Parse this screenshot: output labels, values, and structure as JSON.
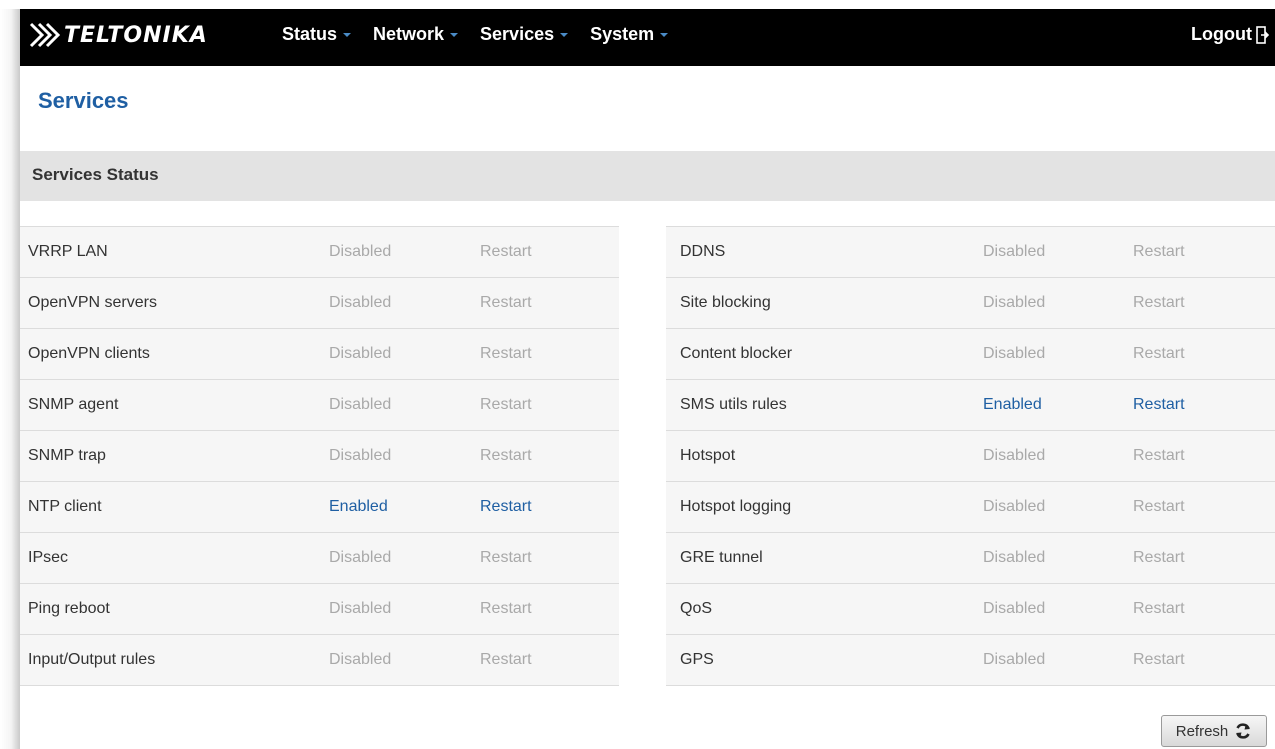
{
  "header": {
    "logo_text": "TELTONIKA",
    "nav": [
      {
        "label": "Status"
      },
      {
        "label": "Network"
      },
      {
        "label": "Services"
      },
      {
        "label": "System"
      }
    ],
    "logout_label": "Logout"
  },
  "page": {
    "title": "Services",
    "section_title": "Services Status"
  },
  "services_left": [
    {
      "name": "VRRP LAN",
      "status": "Disabled",
      "action": "Restart",
      "enabled": false
    },
    {
      "name": "OpenVPN servers",
      "status": "Disabled",
      "action": "Restart",
      "enabled": false
    },
    {
      "name": "OpenVPN clients",
      "status": "Disabled",
      "action": "Restart",
      "enabled": false
    },
    {
      "name": "SNMP agent",
      "status": "Disabled",
      "action": "Restart",
      "enabled": false
    },
    {
      "name": "SNMP trap",
      "status": "Disabled",
      "action": "Restart",
      "enabled": false
    },
    {
      "name": "NTP client",
      "status": "Enabled",
      "action": "Restart",
      "enabled": true
    },
    {
      "name": "IPsec",
      "status": "Disabled",
      "action": "Restart",
      "enabled": false
    },
    {
      "name": "Ping reboot",
      "status": "Disabled",
      "action": "Restart",
      "enabled": false
    },
    {
      "name": "Input/Output rules",
      "status": "Disabled",
      "action": "Restart",
      "enabled": false
    }
  ],
  "services_right": [
    {
      "name": "DDNS",
      "status": "Disabled",
      "action": "Restart",
      "enabled": false
    },
    {
      "name": "Site blocking",
      "status": "Disabled",
      "action": "Restart",
      "enabled": false
    },
    {
      "name": "Content blocker",
      "status": "Disabled",
      "action": "Restart",
      "enabled": false
    },
    {
      "name": "SMS utils rules",
      "status": "Enabled",
      "action": "Restart",
      "enabled": true
    },
    {
      "name": "Hotspot",
      "status": "Disabled",
      "action": "Restart",
      "enabled": false
    },
    {
      "name": "Hotspot logging",
      "status": "Disabled",
      "action": "Restart",
      "enabled": false
    },
    {
      "name": "GRE tunnel",
      "status": "Disabled",
      "action": "Restart",
      "enabled": false
    },
    {
      "name": "QoS",
      "status": "Disabled",
      "action": "Restart",
      "enabled": false
    },
    {
      "name": "GPS",
      "status": "Disabled",
      "action": "Restart",
      "enabled": false
    }
  ],
  "refresh_label": "Refresh",
  "colors": {
    "topbar": "#000000",
    "accent": "#1f5fa3",
    "disabled_text": "#a9a9a9",
    "section_bg": "#e3e3e3"
  },
  "icons": {
    "logo": "teltonika-logo-icon",
    "logout": "logout-icon",
    "refresh": "refresh-icon"
  }
}
